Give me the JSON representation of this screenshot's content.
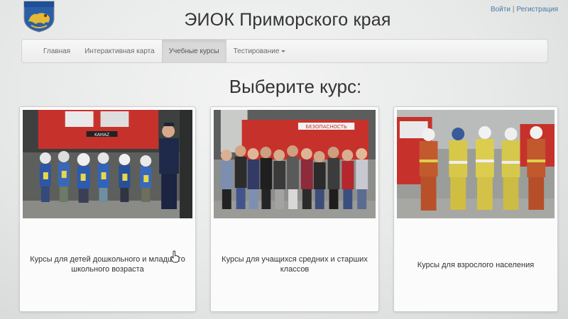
{
  "header": {
    "title": "ЭИОК Приморского края",
    "login_label": "Войти",
    "separator": "|",
    "register_label": "Регистрация"
  },
  "nav": {
    "items": [
      {
        "label": "Главная"
      },
      {
        "label": "Интерактивная карта"
      },
      {
        "label": "Учебные курсы",
        "active": true
      },
      {
        "label": "Тестирование",
        "dropdown": true
      }
    ]
  },
  "main": {
    "heading": "Выберите курс:",
    "courses": [
      {
        "title": "Курсы для детей дошкольного и младшего школьного возраста"
      },
      {
        "title": "Курсы для учащихся средних и старших классов"
      },
      {
        "title": "Курсы для взрослого населения"
      }
    ]
  },
  "photo_text": {
    "truck_brand": "KAMAZ",
    "truck_sign": "БЕЗОПАСНОСТЬ"
  },
  "colors": {
    "link": "#4b78a8",
    "fire_red": "#c6322b",
    "nav_active": "#d9d9d9"
  }
}
